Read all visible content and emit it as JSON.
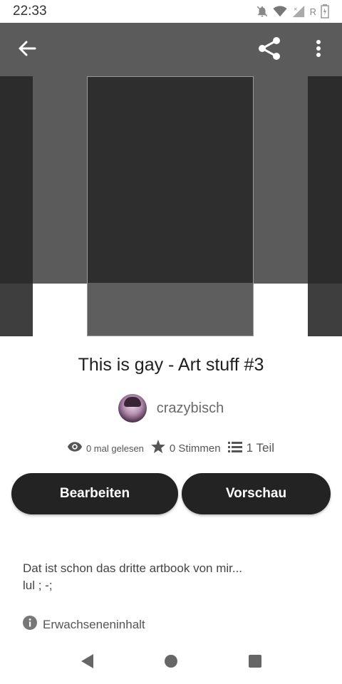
{
  "status_bar": {
    "time": "22:33",
    "carrier_letter": "R"
  },
  "header": {
    "back_icon": "arrow-left-icon",
    "share_icon": "share-icon",
    "more_icon": "more-vertical-icon"
  },
  "story": {
    "title": "This is gay - Art stuff #3",
    "author": "crazybisch",
    "stats": {
      "reads": "0 mal gelesen",
      "votes": "0 Stimmen",
      "parts": "1 Teil"
    },
    "description_line1": "Dat ist schon das dritte artbook von mir...",
    "description_line2": "lul ; -;",
    "mature_label": "Erwachseneninhalt"
  },
  "actions": {
    "edit_label": "Bearbeiten",
    "preview_label": "Vorschau"
  },
  "colors": {
    "button_bg": "#232323",
    "hero_bg": "#5b5b5b",
    "cover_bg": "#2e2e2e"
  }
}
